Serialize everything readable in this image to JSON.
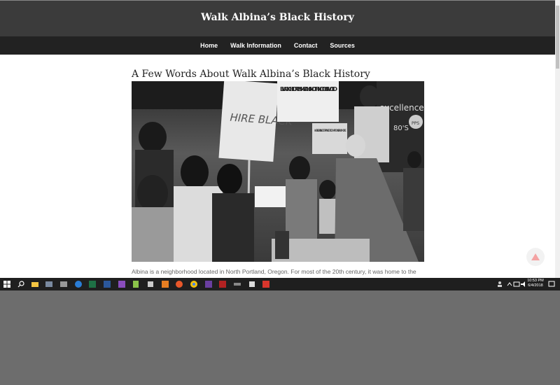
{
  "site": {
    "title": "Walk Albina’s Black History"
  },
  "nav": {
    "items": [
      {
        "label": "Home"
      },
      {
        "label": "Walk Information"
      },
      {
        "label": "Contact"
      },
      {
        "label": "Sources"
      }
    ]
  },
  "article": {
    "title": "A Few Words About Walk Albina’s Black History",
    "intro": "Albina is a neighborhood located in North Portland, Oregon. For most of the 20th century, it was home to the"
  },
  "hero_image": {
    "signs": [
      "HIRE BLACK",
      "BLACK CHILDREN MEANS NOTHING TO GISVOLD",
      "KARRIGAN IS NOT OPT TAKE FOR COMPROMISE ANYMORE",
      "excellence",
      "80'S",
      "PPS"
    ]
  },
  "taskbar": {
    "time": "10:53 PM",
    "date": "6/4/2018"
  },
  "colors": {
    "header_bg": "#3b3b3b",
    "nav_bg": "#222222",
    "taskbar_bg": "#1f1f1f",
    "desktop_bg": "#6d6d6d",
    "back_to_top_arrow": "#f4a3a3"
  }
}
